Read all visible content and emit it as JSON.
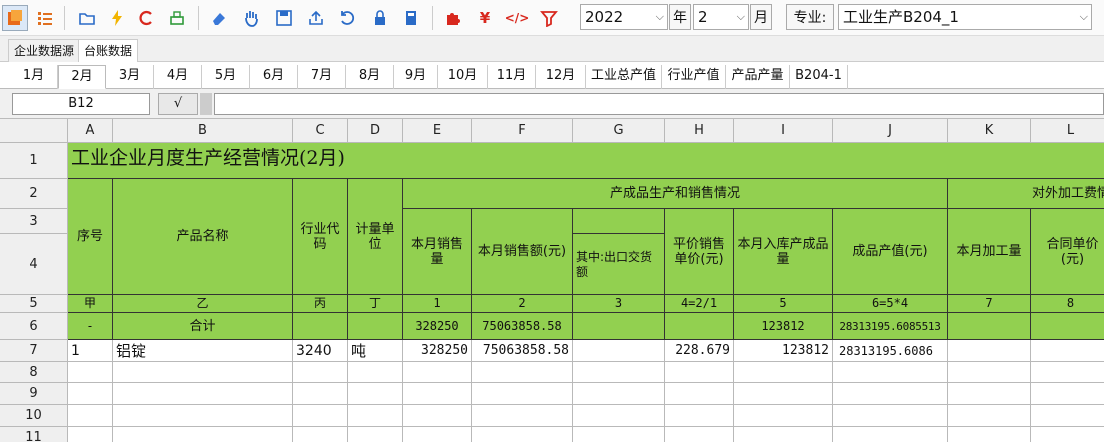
{
  "toolbar": {
    "year": "2022",
    "year_label": "年",
    "month": "2",
    "month_label": "月",
    "major_label": "专业:",
    "major_value": "工业生产B204_1"
  },
  "top_tabs": [
    "企业数据源",
    "台账数据"
  ],
  "sheet_tabs": [
    "1月",
    "2月",
    "3月",
    "4月",
    "5月",
    "6月",
    "7月",
    "8月",
    "9月",
    "10月",
    "11月",
    "12月",
    "工业总产值",
    "行业产值",
    "产品产量",
    "B204-1"
  ],
  "formula_bar": {
    "cell_ref": "B12",
    "confirm": "√",
    "value": ""
  },
  "columns": [
    "A",
    "B",
    "C",
    "D",
    "E",
    "F",
    "G",
    "H",
    "I",
    "J",
    "K",
    "L"
  ],
  "rows": [
    "1",
    "2",
    "3",
    "4",
    "5",
    "6",
    "7",
    "8",
    "9",
    "10",
    "11"
  ],
  "sheet": {
    "title": "工业企业月度生产经营情况(2月)",
    "h_seq": "序号",
    "h_name": "产品名称",
    "h_code": "行业代码",
    "h_unit": "计量单位",
    "h_group1": "产成品生产和销售情况",
    "h_group2": "对外加工费情",
    "h_e": "本月销售量",
    "h_f": "本月销售额(元)",
    "h_g": "其中:出口交货额",
    "h_h": "平价销售单价(元)",
    "h_i": "本月入库产成品量",
    "h_j": "成品产值(元)",
    "h_k": "本月加工量",
    "h_l": "合同单价(元)",
    "r5": [
      "甲",
      "乙",
      "丙",
      "丁",
      "1",
      "2",
      "3",
      "4=2/1",
      "5",
      "6=5*4",
      "7",
      "8"
    ],
    "r6": [
      "-",
      "合计",
      "",
      "",
      "328250",
      "75063858.58",
      "",
      "",
      "123812",
      "28313195.6085513",
      "",
      ""
    ],
    "r7": [
      "1",
      "铝锭",
      "3240",
      "吨",
      "328250",
      "75063858.58",
      "",
      "228.679",
      "123812",
      "28313195.6086",
      "",
      ""
    ]
  }
}
